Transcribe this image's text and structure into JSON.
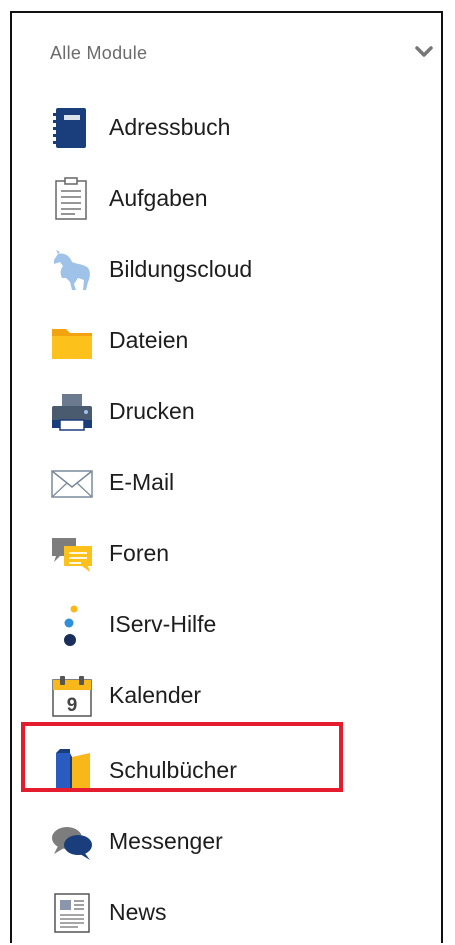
{
  "header": {
    "title": "Alle Module",
    "chevron_icon": "chevron-down-icon"
  },
  "items": [
    {
      "label": "Adressbuch",
      "icon": "address-book-icon"
    },
    {
      "label": "Aufgaben",
      "icon": "clipboard-icon"
    },
    {
      "label": "Bildungscloud",
      "icon": "horse-icon"
    },
    {
      "label": "Dateien",
      "icon": "folder-icon"
    },
    {
      "label": "Drucken",
      "icon": "printer-icon"
    },
    {
      "label": "E-Mail",
      "icon": "envelope-icon"
    },
    {
      "label": "Foren",
      "icon": "forum-icon"
    },
    {
      "label": "IServ-Hilfe",
      "icon": "help-dots-icon"
    },
    {
      "label": "Kalender",
      "icon": "calendar-icon"
    },
    {
      "label": "Schulbücher",
      "icon": "books-icon",
      "highlighted": true
    },
    {
      "label": "Messenger",
      "icon": "chat-bubbles-icon"
    },
    {
      "label": "News",
      "icon": "newspaper-icon"
    }
  ],
  "colors": {
    "highlight_border": "#e41c2d",
    "navy": "#1a3d7c",
    "yellow": "#f8b81a"
  }
}
